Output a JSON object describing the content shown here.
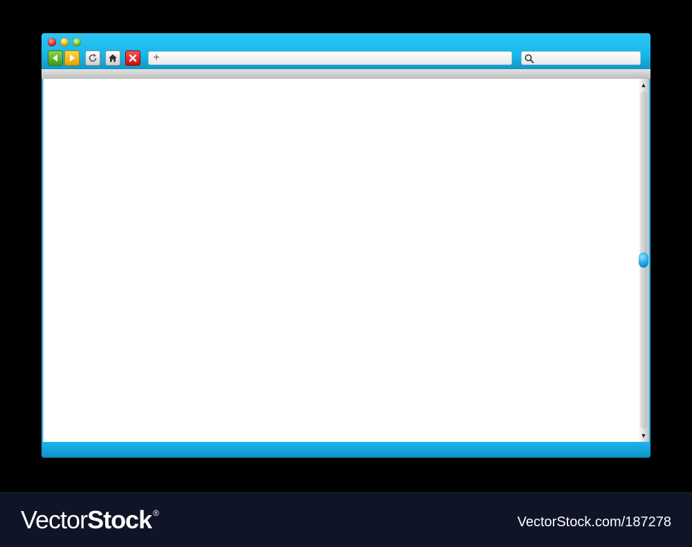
{
  "window": {
    "address_bar": {
      "value": "",
      "placeholder": "",
      "add_label": "+"
    },
    "search_bar": {
      "value": "",
      "placeholder": ""
    },
    "scroll_position": 0.5
  },
  "icons": {
    "traffic_lights": [
      "close-dot",
      "minimize-dot",
      "maximize-dot"
    ],
    "toolbar": [
      "back-arrow-icon",
      "forward-arrow-icon",
      "reload-icon",
      "home-icon",
      "stop-x-icon",
      "search-icon"
    ]
  },
  "colors": {
    "frame": "#1cb3e6",
    "back_button": "#4caf23",
    "forward_button": "#f2b400",
    "stop_button": "#d81515",
    "scroll_thumb": "#1aa6e6",
    "watermark_bar": "#0f1426"
  },
  "watermark": {
    "brand_light": "Vector",
    "brand_bold": "Stock",
    "registered": "®",
    "url": "VectorStock.com/187278"
  }
}
